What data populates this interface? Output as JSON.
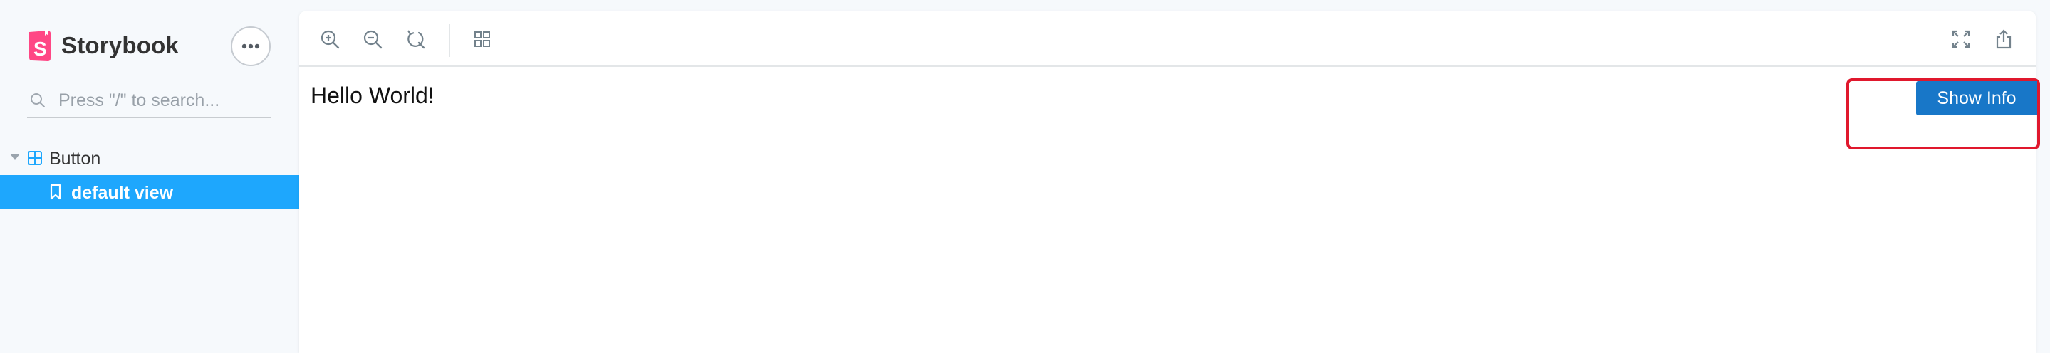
{
  "sidebar": {
    "brand": {
      "title": "Storybook",
      "logo_letter": "S",
      "logo_color": "#ff4785"
    },
    "menu_icon": "ellipsis-icon",
    "search": {
      "placeholder": "Press \"/\" to search...",
      "value": ""
    },
    "tree": {
      "group_label": "Button",
      "group_icon": "component-icon",
      "story_label": "default view",
      "story_icon": "bookmark-icon",
      "selected_color": "#1ea7fd"
    }
  },
  "toolbar": {
    "left_tools": [
      "zoom-in-icon",
      "zoom-out-icon",
      "zoom-reset-icon",
      "grid-icon"
    ],
    "right_tools": [
      "fullscreen-icon",
      "share-icon"
    ]
  },
  "preview": {
    "text": "Hello World!",
    "button_label": "Show Info",
    "button_color": "#1877c8",
    "highlight_color": "#e0182d"
  }
}
